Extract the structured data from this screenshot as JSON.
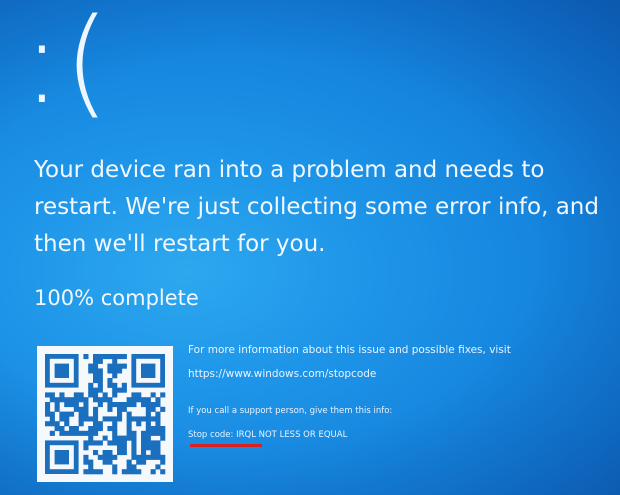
{
  "screen": {
    "sad_face": ":(",
    "headline": "Your device ran into a problem and needs to restart. We're just collecting some error info, and then we'll restart for you.",
    "progress_text": "100% complete",
    "progress_value": 100
  },
  "info": {
    "more_info": "For more information about this issue and possible fixes, visit",
    "url": "https://www.windows.com/stopcode",
    "support_note": "If you call a support person, give them this info:",
    "stop_code_label": "Stop code:",
    "stop_code": "IRQL NOT LESS OR EQUAL"
  },
  "colors": {
    "background": "#1e95e8",
    "text": "#f2f8ff",
    "annotation_underline": "#d92020"
  }
}
